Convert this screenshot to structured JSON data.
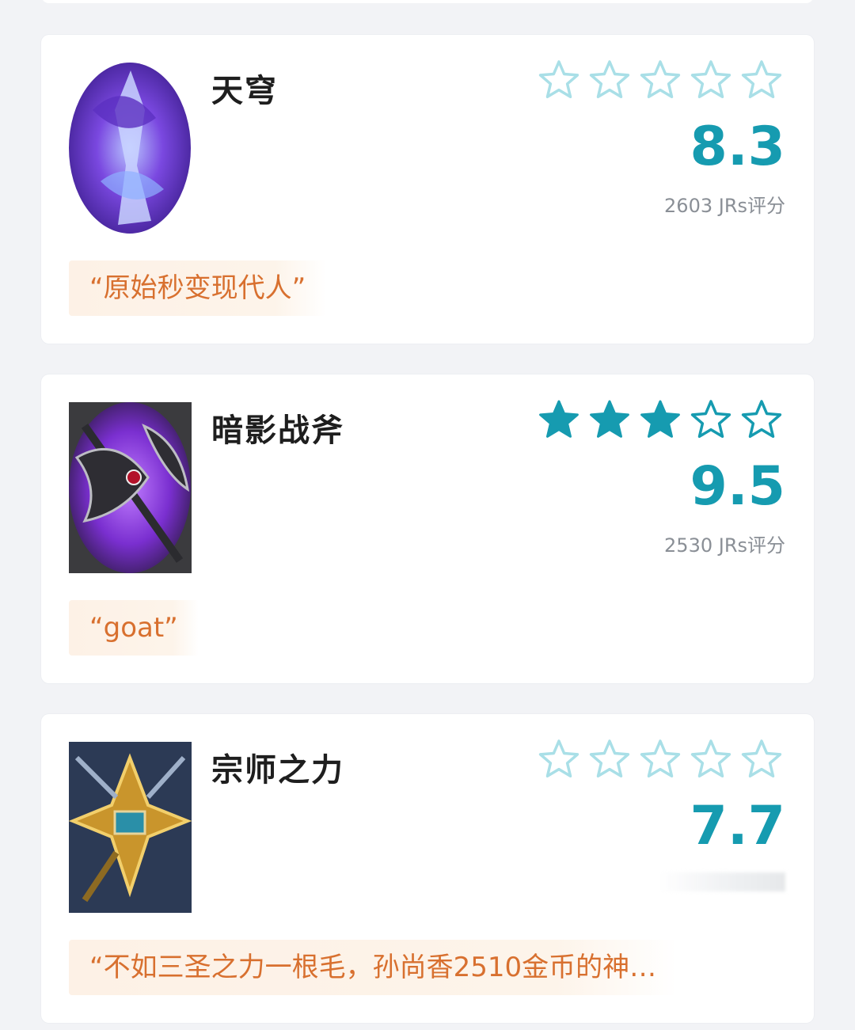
{
  "items": [
    {
      "name": "天穹",
      "rating_stars_filled": 0,
      "rating_stars_total": 5,
      "score": "8.3",
      "raters": "2603 JRs评分",
      "quote": "“原始秒变现代人”",
      "icon": "purple-blue-crystal-icon"
    },
    {
      "name": "暗影战斧",
      "rating_stars_filled": 3,
      "rating_stars_total": 5,
      "score": "9.5",
      "raters": "2530 JRs评分",
      "quote": "“goat”",
      "icon": "shadow-axe-icon"
    },
    {
      "name": "宗师之力",
      "rating_stars_filled": 0,
      "rating_stars_total": 5,
      "score": "7.7",
      "raters": "",
      "quote": "“不如三圣之力一根毛，孙尚香2510金币的神…",
      "icon": "golden-emblem-icon"
    }
  ],
  "colors": {
    "accent": "#169bb0",
    "star_filled": "#169bb0",
    "star_empty_outline": "#a9dfe7",
    "quote_text": "#d8702f",
    "quote_bg": "#fdf1e6"
  }
}
